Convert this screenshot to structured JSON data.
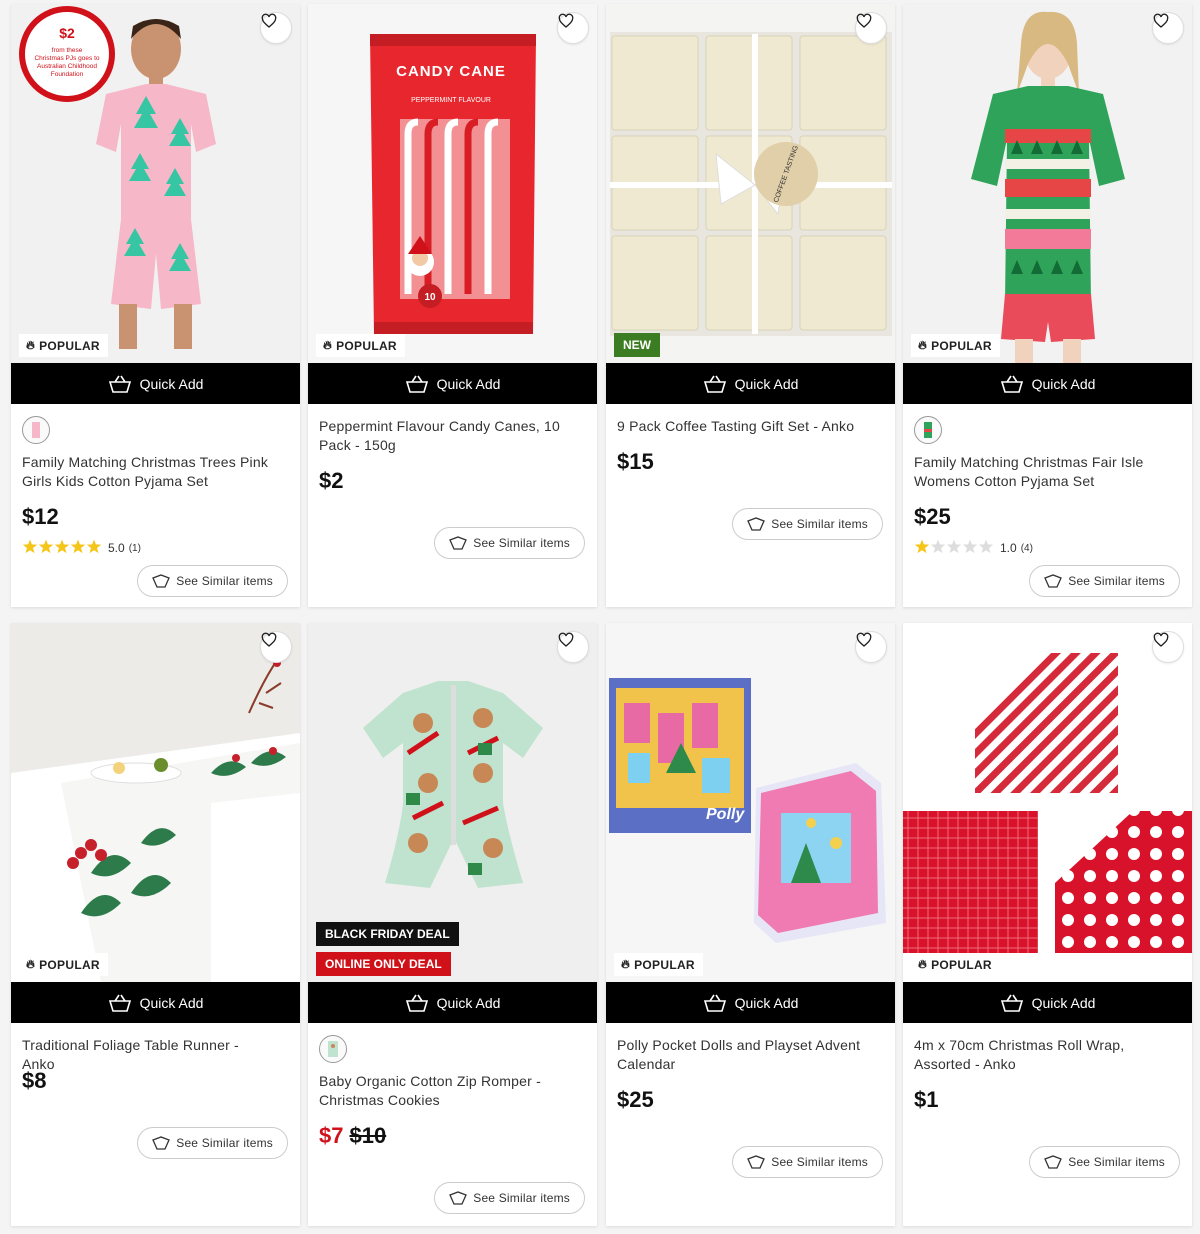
{
  "common": {
    "quick_add_label": "Quick Add",
    "see_similar_label": "See Similar items",
    "popular_label": "POPULAR"
  },
  "products": [
    {
      "name": "Family Matching Christmas Trees Pink Girls Kids Cotton Pyjama Set",
      "price": "$12",
      "badge": "POPULAR",
      "rating": "5.0",
      "rating_count": "(1)",
      "stars": 5,
      "promo_top": "$2",
      "promo_text": "from these Christmas PJs goes to Australian Childhood Foundation"
    },
    {
      "name": "Peppermint Flavour Candy Canes, 10 Pack - 150g",
      "price": "$2",
      "badge": "POPULAR",
      "package_text": "CANDY CANE",
      "package_sub": "PEPPERMINT FLAVOUR"
    },
    {
      "name": "9 Pack Coffee Tasting Gift Set - Anko",
      "price": "$15",
      "badge": "NEW",
      "tag_text": "COFFEE TASTING"
    },
    {
      "name": "Family Matching Christmas Fair Isle Womens Cotton Pyjama Set",
      "price": "$25",
      "badge": "POPULAR",
      "rating": "1.0",
      "rating_count": "(4)",
      "stars": 1
    },
    {
      "name": "Traditional Foliage Table Runner - Anko",
      "price": "$8",
      "badge": "POPULAR"
    },
    {
      "name": "Baby Organic Cotton Zip Romper - Christmas Cookies",
      "price": "$7",
      "was_price": "$10",
      "deal_1": "BLACK FRIDAY DEAL",
      "deal_2": "ONLINE ONLY DEAL"
    },
    {
      "name": "Polly Pocket Dolls and Playset Advent Calendar",
      "price": "$25",
      "badge": "POPULAR",
      "box_text": "Polly"
    },
    {
      "name": "4m x 70cm Christmas Roll Wrap, Assorted - Anko",
      "price": "$1",
      "badge": "POPULAR"
    }
  ],
  "colors": {
    "star": "#f5c518",
    "sale_red": "#d0111a",
    "new_green": "#3c7d23",
    "quick_add_bg": "#000000"
  }
}
